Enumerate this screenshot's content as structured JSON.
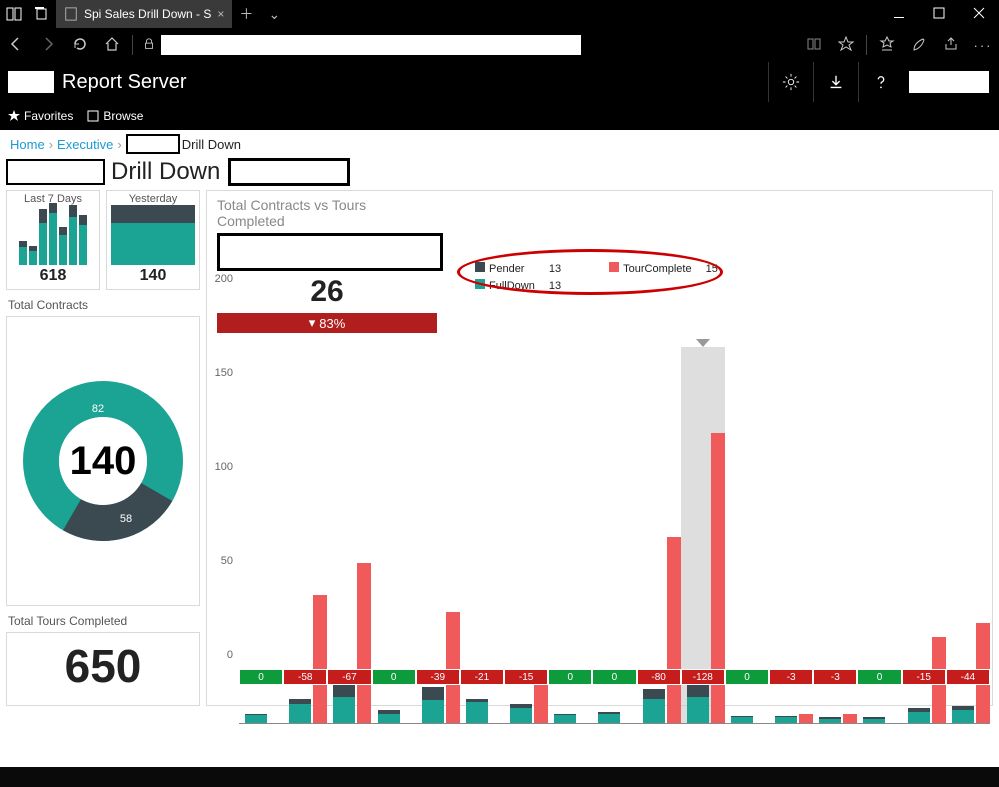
{
  "browser": {
    "tab_title": "Spi Sales Drill Down - S"
  },
  "report_server": {
    "title": "Report Server",
    "toolbar": {
      "favorites": "Favorites",
      "browse": "Browse"
    }
  },
  "breadcrumb": {
    "home": "Home",
    "section": "Executive",
    "page": "Drill Down"
  },
  "page_title": "Drill Down",
  "left": {
    "last7": {
      "label": "Last 7 Days",
      "value": "618"
    },
    "yesterday": {
      "label": "Yesterday",
      "value": "140"
    },
    "total_contracts_label": "Total Contracts",
    "donut": {
      "center": "140",
      "top": "82",
      "bottom": "58"
    },
    "total_tours_label": "Total Tours Completed",
    "total_tours_value": "650"
  },
  "kpi": {
    "title": "Total Contracts vs Tours Completed",
    "value": "26",
    "delta": "83%",
    "legend": {
      "pender": "Pender",
      "pender_val": "13",
      "fulldown": "FullDown",
      "fulldown_val": "13",
      "tour": "TourComplete",
      "tour_val": "15"
    }
  },
  "chart_data": {
    "type": "bar",
    "ylabel": "",
    "ylim": [
      0,
      200
    ],
    "y_ticks": [
      0,
      50,
      100,
      150,
      200
    ],
    "categories_delta": [
      0,
      -58,
      -67,
      0,
      -39,
      -21,
      -15,
      0,
      0,
      -80,
      -128,
      0,
      -3,
      -3,
      0,
      -15,
      -44
    ],
    "series": [
      {
        "name": "FullDown",
        "color": "#1ba394",
        "values": [
          4,
          10,
          14,
          5,
          12,
          11,
          8,
          4,
          5,
          13,
          14,
          3,
          3,
          2,
          2,
          6,
          7
        ]
      },
      {
        "name": "Pender",
        "color": "#3b4a51",
        "values": [
          1,
          3,
          6,
          2,
          7,
          2,
          2,
          1,
          1,
          5,
          11,
          1,
          1,
          1,
          1,
          2,
          2
        ]
      },
      {
        "name": "TourComplete",
        "color": "#f15a5a",
        "values": [
          0,
          68,
          85,
          0,
          59,
          0,
          24,
          0,
          0,
          99,
          154,
          0,
          5,
          5,
          0,
          46,
          53
        ]
      }
    ],
    "highlight_index": 10
  }
}
